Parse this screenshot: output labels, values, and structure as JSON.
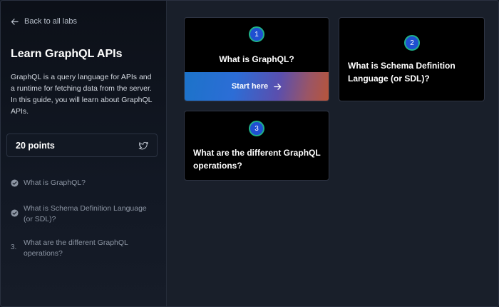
{
  "sidebar": {
    "back_label": "Back to all labs",
    "title": "Learn GraphQL APIs",
    "description": "GraphQL is a query language for APIs and a runtime for fetching data from the server. In this guide, you will learn about GraphQL APIs.",
    "points": "20 points",
    "share_icon": "twitter-icon",
    "steps": [
      {
        "label": "What is GraphQL?",
        "status": "done",
        "icon": "check-circle-icon"
      },
      {
        "label": "What is Schema Definition Language (or SDL)?",
        "status": "done",
        "icon": "check-circle-icon"
      },
      {
        "number": "3.",
        "label": "What are the different GraphQL operations?",
        "status": "pending"
      }
    ]
  },
  "cards": [
    {
      "number": "1",
      "title": "What is GraphQL?",
      "action_label": "Start here"
    },
    {
      "number": "2",
      "title": "What is Schema Definition Language (or SDL)?"
    },
    {
      "number": "3",
      "title": "What are the different GraphQL operations?"
    }
  ],
  "colors": {
    "badge_fill": "#1f4fd1",
    "badge_ring": "#1fb28a",
    "card_bg": "#000000",
    "page_bg": "#191f2a"
  }
}
